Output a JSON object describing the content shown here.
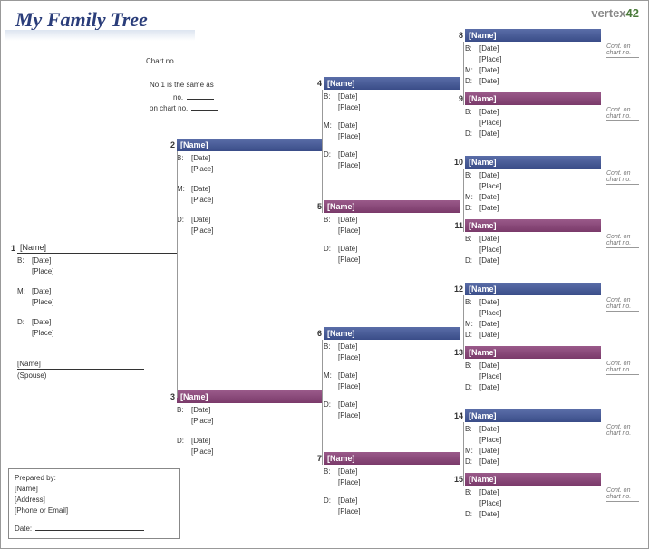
{
  "title": "My Family Tree",
  "logo": {
    "text": "vertex",
    "suffix": "42"
  },
  "meta": {
    "chart_no_label": "Chart no.",
    "no1_text": "No.1 is the same as",
    "no_label": "no.",
    "onchart_label": "on chart no."
  },
  "common": {
    "name": "[Name]",
    "b": "B:",
    "m": "M:",
    "d": "D:",
    "date": "[Date]",
    "place": "[Place]",
    "cont": "Cont. on chart no."
  },
  "spouse": {
    "name": "[Name]",
    "label": "(Spouse)"
  },
  "footer": {
    "prepared": "Prepared by:",
    "name": "[Name]",
    "address": "[Address]",
    "phone": "[Phone or Email]",
    "date": "Date:"
  },
  "entries": {
    "e1": {
      "num": "1"
    },
    "e2": {
      "num": "2"
    },
    "e3": {
      "num": "3"
    },
    "e4": {
      "num": "4"
    },
    "e5": {
      "num": "5"
    },
    "e6": {
      "num": "6"
    },
    "e7": {
      "num": "7"
    },
    "e8": {
      "num": "8"
    },
    "e9": {
      "num": "9"
    },
    "e10": {
      "num": "10"
    },
    "e11": {
      "num": "11"
    },
    "e12": {
      "num": "12"
    },
    "e13": {
      "num": "13"
    },
    "e14": {
      "num": "14"
    },
    "e15": {
      "num": "15"
    }
  }
}
